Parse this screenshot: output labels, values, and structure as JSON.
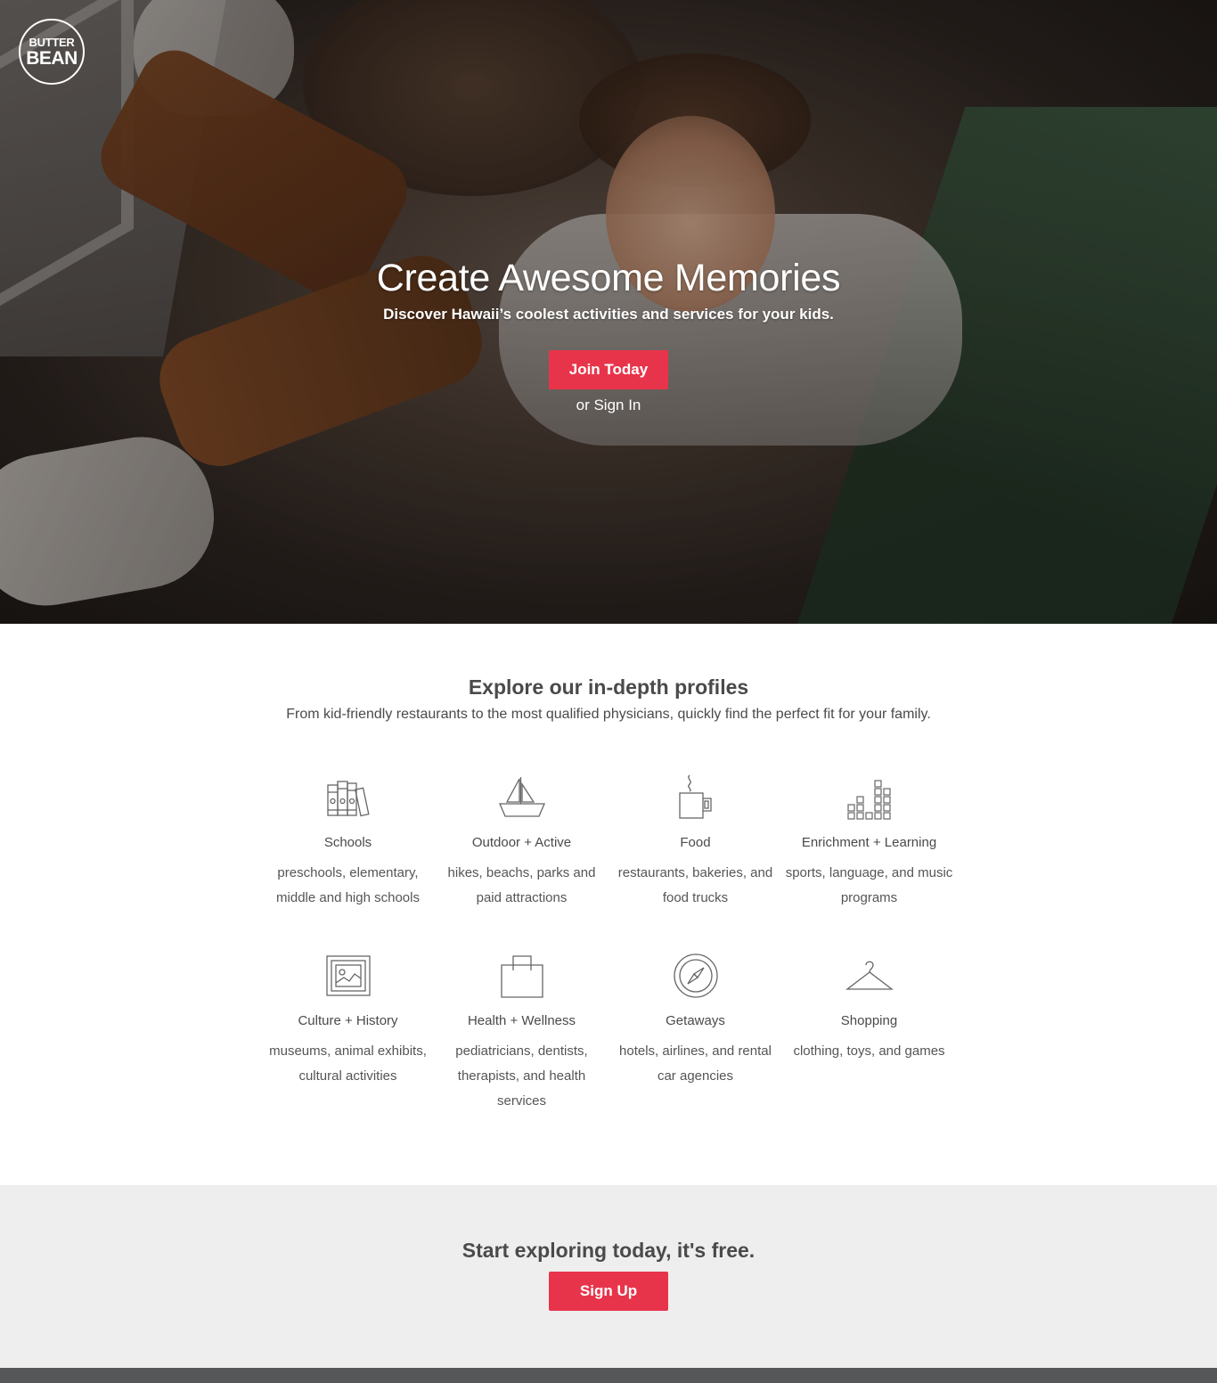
{
  "logo": {
    "line1": "BUTTER",
    "line2": "BEAN"
  },
  "hero": {
    "title": "Create Awesome Memories",
    "subtitle": "Discover Hawaii’s coolest activities and services for your kids.",
    "cta_label": "Join Today",
    "signin_label": "or Sign In"
  },
  "profiles": {
    "title": "Explore our in-depth profiles",
    "subtitle": "From kid-friendly restaurants to the most qualified physicians, quickly find the perfect fit for your family.",
    "categories": [
      {
        "name": "Schools",
        "desc": "preschools, elementary, middle and high schools",
        "icon": "books-icon"
      },
      {
        "name": "Outdoor + Active",
        "desc": "hikes, beachs, parks and paid attractions",
        "icon": "sailboat-icon"
      },
      {
        "name": "Food",
        "desc": "restaurants, bakeries, and food trucks",
        "icon": "coffee-mug-icon"
      },
      {
        "name": "Enrichment + Learning",
        "desc": "sports, language, and music programs",
        "icon": "equalizer-icon"
      },
      {
        "name": "Culture + History",
        "desc": "museums, animal exhibits, cultural activities",
        "icon": "framed-picture-icon"
      },
      {
        "name": "Health + Wellness",
        "desc": "pediatricians, dentists, therapists, and health services",
        "icon": "shopping-bag-icon"
      },
      {
        "name": "Getaways",
        "desc": "hotels, airlines, and rental car agencies",
        "icon": "compass-icon"
      },
      {
        "name": "Shopping",
        "desc": "clothing, toys, and games",
        "icon": "hanger-icon"
      }
    ]
  },
  "cta": {
    "title": "Start exploring today, it's free.",
    "button_label": "Sign Up"
  },
  "colors": {
    "accent": "#e8344a",
    "text": "#4a4a4a",
    "cta_bg": "#eeeeee",
    "footer": "#555759"
  }
}
